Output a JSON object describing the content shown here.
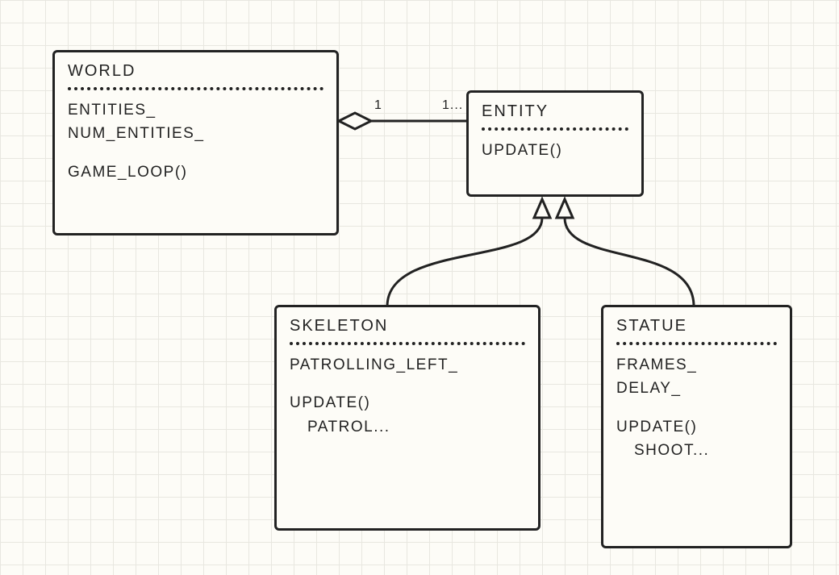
{
  "diagram": {
    "type": "uml-class",
    "classes": {
      "world": {
        "name": "WORLD",
        "attrs": [
          "ENTITIES_",
          "NUM_ENTITIES_"
        ],
        "methods": [
          "GAME_LOOP()"
        ]
      },
      "entity": {
        "name": "ENTITY",
        "attrs": [],
        "methods": [
          "UPDATE()"
        ]
      },
      "skeleton": {
        "name": "SKELETON",
        "attrs": [
          "PATROLLING_LEFT_"
        ],
        "methods": [
          "UPDATE()",
          "PATROL..."
        ]
      },
      "statue": {
        "name": "STATUE",
        "attrs": [
          "FRAMES_",
          "DELAY_"
        ],
        "methods": [
          "UPDATE()",
          "SHOOT..."
        ]
      }
    },
    "relations": [
      {
        "kind": "aggregation",
        "from": "world",
        "to": "entity",
        "mult_from": "1",
        "mult_to": "1..."
      },
      {
        "kind": "inheritance",
        "from": "skeleton",
        "to": "entity"
      },
      {
        "kind": "inheritance",
        "from": "statue",
        "to": "entity"
      }
    ]
  }
}
